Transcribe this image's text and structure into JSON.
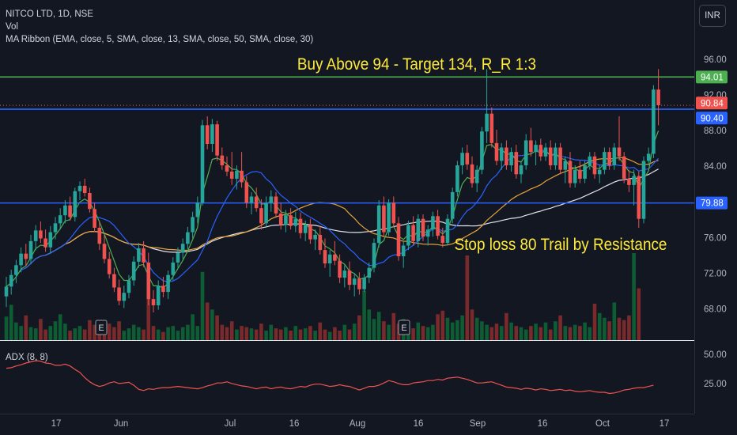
{
  "legend": {
    "symbol_line": "NITCO LTD, 1D, NSE",
    "vol_label": "Vol",
    "ma_label": "MA Ribbon (EMA, close, 5, SMA, close, 13, SMA, close, 50, SMA, close, 30)"
  },
  "currency_button": "INR",
  "annotations": {
    "buy_text": "Buy Above 94 - Target 134, R_R 1:3",
    "stop_text": "Stop loss 80 Trail by Resistance"
  },
  "adx_label": "ADX (8, 8)",
  "colors": {
    "background": "#131722",
    "up": "#26a69a",
    "down": "#ef5350",
    "vol_up": "#0e5c34",
    "vol_down": "#7a2a2b",
    "green_line": "#4caf50",
    "blue_line": "#2962ff",
    "ema5": "#4caf50",
    "sma13": "#2962ff",
    "sma30": "#e6a23c",
    "sma50": "#e0e3eb",
    "adx": "#ef5350",
    "annotation_text": "#ffeb3b"
  },
  "chart_data": {
    "type": "candlestick",
    "symbol": "NITCO LTD",
    "interval": "1D",
    "exchange": "NSE",
    "price_axis": {
      "ticks": [
        "96.00",
        "92.00",
        "88.00",
        "84.00",
        "80.00",
        "76.00",
        "72.00",
        "68.00"
      ],
      "range": [
        64.5,
        97.5
      ]
    },
    "time_axis": {
      "ticks": [
        "17",
        "Jun",
        "Jul",
        "16",
        "Aug",
        "16",
        "Sep",
        "16",
        "Oct",
        "17"
      ]
    },
    "adx_axis": {
      "ticks": [
        "50.00",
        "25.00"
      ],
      "range": [
        0,
        60
      ]
    },
    "horizontal_lines": [
      {
        "price": 94.01,
        "color": "#4caf50",
        "label": "94.01"
      },
      {
        "price": 90.4,
        "color": "#2962ff",
        "label": "90.40"
      },
      {
        "price": 79.88,
        "color": "#2962ff",
        "label": "79.88"
      }
    ],
    "last_price": {
      "value": 90.84,
      "label": "90.84"
    },
    "earnings_markers": [
      {
        "label": "E",
        "date": "Jun"
      },
      {
        "label": "E",
        "date": "Aug"
      }
    ],
    "candles": [
      {
        "o": 69.4,
        "h": 71.6,
        "l": 68.2,
        "c": 70.5
      },
      {
        "o": 70.5,
        "h": 72.4,
        "l": 69.6,
        "c": 71.8
      },
      {
        "o": 71.8,
        "h": 73.5,
        "l": 70.9,
        "c": 72.9
      },
      {
        "o": 72.9,
        "h": 74.9,
        "l": 72.1,
        "c": 74.2
      },
      {
        "o": 74.2,
        "h": 75.3,
        "l": 72.8,
        "c": 73.6
      },
      {
        "o": 73.6,
        "h": 76.3,
        "l": 73.0,
        "c": 75.6
      },
      {
        "o": 75.6,
        "h": 77.4,
        "l": 74.6,
        "c": 76.8
      },
      {
        "o": 76.8,
        "h": 77.8,
        "l": 75.4,
        "c": 75.9
      },
      {
        "o": 75.9,
        "h": 76.9,
        "l": 74.4,
        "c": 74.9
      },
      {
        "o": 74.9,
        "h": 77.3,
        "l": 74.2,
        "c": 76.6
      },
      {
        "o": 76.6,
        "h": 78.3,
        "l": 75.8,
        "c": 77.6
      },
      {
        "o": 77.6,
        "h": 79.3,
        "l": 76.9,
        "c": 78.5
      },
      {
        "o": 78.5,
        "h": 80.2,
        "l": 77.6,
        "c": 79.6
      },
      {
        "o": 79.6,
        "h": 80.6,
        "l": 77.9,
        "c": 78.3
      },
      {
        "o": 78.3,
        "h": 81.6,
        "l": 77.8,
        "c": 81.2
      },
      {
        "o": 81.2,
        "h": 82.3,
        "l": 80.2,
        "c": 81.8
      },
      {
        "o": 81.8,
        "h": 82.6,
        "l": 80.6,
        "c": 81.0
      },
      {
        "o": 81.0,
        "h": 81.6,
        "l": 78.8,
        "c": 79.2
      },
      {
        "o": 79.2,
        "h": 79.9,
        "l": 76.6,
        "c": 77.1
      },
      {
        "o": 77.1,
        "h": 77.8,
        "l": 74.6,
        "c": 75.3
      },
      {
        "o": 75.3,
        "h": 76.3,
        "l": 73.1,
        "c": 73.6
      },
      {
        "o": 73.6,
        "h": 74.4,
        "l": 71.4,
        "c": 71.9
      },
      {
        "o": 71.9,
        "h": 72.6,
        "l": 69.9,
        "c": 70.4
      },
      {
        "o": 70.4,
        "h": 71.3,
        "l": 68.4,
        "c": 68.9
      },
      {
        "o": 68.9,
        "h": 70.6,
        "l": 68.1,
        "c": 69.8
      },
      {
        "o": 69.8,
        "h": 71.8,
        "l": 69.2,
        "c": 71.2
      },
      {
        "o": 71.2,
        "h": 73.9,
        "l": 70.6,
        "c": 73.3
      },
      {
        "o": 73.3,
        "h": 75.4,
        "l": 72.6,
        "c": 74.8
      },
      {
        "o": 74.8,
        "h": 75.6,
        "l": 72.7,
        "c": 73.2
      },
      {
        "o": 73.2,
        "h": 74.3,
        "l": 68.4,
        "c": 69.1
      },
      {
        "o": 69.1,
        "h": 70.1,
        "l": 67.6,
        "c": 68.4
      },
      {
        "o": 68.4,
        "h": 71.2,
        "l": 67.9,
        "c": 70.6
      },
      {
        "o": 70.6,
        "h": 71.6,
        "l": 69.3,
        "c": 69.9
      },
      {
        "o": 69.9,
        "h": 72.3,
        "l": 69.1,
        "c": 71.8
      },
      {
        "o": 71.8,
        "h": 73.8,
        "l": 71.2,
        "c": 73.2
      },
      {
        "o": 73.2,
        "h": 74.9,
        "l": 72.6,
        "c": 74.3
      },
      {
        "o": 74.3,
        "h": 75.9,
        "l": 73.6,
        "c": 75.3
      },
      {
        "o": 75.3,
        "h": 77.2,
        "l": 74.7,
        "c": 76.6
      },
      {
        "o": 76.6,
        "h": 78.9,
        "l": 75.9,
        "c": 78.3
      },
      {
        "o": 78.3,
        "h": 80.6,
        "l": 77.6,
        "c": 79.9
      },
      {
        "o": 79.9,
        "h": 89.2,
        "l": 79.6,
        "c": 88.6
      },
      {
        "o": 88.6,
        "h": 89.6,
        "l": 85.9,
        "c": 86.5
      },
      {
        "o": 86.5,
        "h": 89.3,
        "l": 85.6,
        "c": 88.7
      },
      {
        "o": 88.7,
        "h": 89.1,
        "l": 84.6,
        "c": 85.2
      },
      {
        "o": 85.2,
        "h": 86.1,
        "l": 83.6,
        "c": 84.1
      },
      {
        "o": 84.1,
        "h": 85.1,
        "l": 82.9,
        "c": 83.4
      },
      {
        "o": 83.4,
        "h": 85.6,
        "l": 81.9,
        "c": 82.6
      },
      {
        "o": 82.6,
        "h": 84.1,
        "l": 81.4,
        "c": 83.5
      },
      {
        "o": 83.5,
        "h": 85.6,
        "l": 81.6,
        "c": 82.2
      },
      {
        "o": 82.2,
        "h": 82.9,
        "l": 79.3,
        "c": 79.9
      },
      {
        "o": 79.9,
        "h": 81.1,
        "l": 78.6,
        "c": 80.6
      },
      {
        "o": 80.6,
        "h": 81.6,
        "l": 78.9,
        "c": 79.3
      },
      {
        "o": 79.3,
        "h": 80.3,
        "l": 76.9,
        "c": 77.6
      },
      {
        "o": 77.6,
        "h": 80.6,
        "l": 77.2,
        "c": 79.9
      },
      {
        "o": 79.9,
        "h": 81.3,
        "l": 78.9,
        "c": 80.6
      },
      {
        "o": 80.6,
        "h": 81.1,
        "l": 78.2,
        "c": 78.7
      },
      {
        "o": 78.7,
        "h": 79.9,
        "l": 76.9,
        "c": 77.4
      },
      {
        "o": 77.4,
        "h": 79.1,
        "l": 76.6,
        "c": 78.5
      },
      {
        "o": 78.5,
        "h": 79.3,
        "l": 76.9,
        "c": 77.3
      },
      {
        "o": 77.3,
        "h": 78.9,
        "l": 76.6,
        "c": 78.1
      },
      {
        "o": 78.1,
        "h": 78.8,
        "l": 75.9,
        "c": 76.5
      },
      {
        "o": 76.5,
        "h": 77.9,
        "l": 75.6,
        "c": 77.4
      },
      {
        "o": 77.4,
        "h": 78.1,
        "l": 75.3,
        "c": 75.8
      },
      {
        "o": 75.8,
        "h": 76.9,
        "l": 74.6,
        "c": 76.3
      },
      {
        "o": 76.3,
        "h": 77.3,
        "l": 74.1,
        "c": 74.6
      },
      {
        "o": 74.6,
        "h": 75.9,
        "l": 72.6,
        "c": 73.1
      },
      {
        "o": 73.1,
        "h": 74.6,
        "l": 71.6,
        "c": 74.1
      },
      {
        "o": 74.1,
        "h": 75.6,
        "l": 72.9,
        "c": 73.4
      },
      {
        "o": 73.4,
        "h": 74.1,
        "l": 70.9,
        "c": 71.5
      },
      {
        "o": 71.5,
        "h": 72.9,
        "l": 70.4,
        "c": 72.3
      },
      {
        "o": 72.3,
        "h": 73.3,
        "l": 70.1,
        "c": 70.7
      },
      {
        "o": 70.7,
        "h": 71.9,
        "l": 69.4,
        "c": 71.4
      },
      {
        "o": 71.4,
        "h": 72.1,
        "l": 69.6,
        "c": 70.2
      },
      {
        "o": 70.2,
        "h": 71.9,
        "l": 69.9,
        "c": 71.5
      },
      {
        "o": 71.5,
        "h": 73.2,
        "l": 70.9,
        "c": 72.6
      },
      {
        "o": 72.6,
        "h": 75.9,
        "l": 72.1,
        "c": 75.4
      },
      {
        "o": 75.4,
        "h": 80.2,
        "l": 74.9,
        "c": 79.6
      },
      {
        "o": 79.6,
        "h": 80.6,
        "l": 76.1,
        "c": 76.6
      },
      {
        "o": 76.6,
        "h": 80.3,
        "l": 76.2,
        "c": 79.9
      },
      {
        "o": 79.9,
        "h": 80.6,
        "l": 77.2,
        "c": 77.6
      },
      {
        "o": 77.6,
        "h": 78.3,
        "l": 73.4,
        "c": 73.9
      },
      {
        "o": 73.9,
        "h": 75.6,
        "l": 72.6,
        "c": 75.1
      },
      {
        "o": 75.1,
        "h": 77.9,
        "l": 74.6,
        "c": 77.4
      },
      {
        "o": 77.4,
        "h": 78.4,
        "l": 75.1,
        "c": 75.6
      },
      {
        "o": 75.6,
        "h": 78.6,
        "l": 74.9,
        "c": 78.1
      },
      {
        "o": 78.1,
        "h": 78.6,
        "l": 75.6,
        "c": 76.1
      },
      {
        "o": 76.1,
        "h": 77.4,
        "l": 75.1,
        "c": 76.9
      },
      {
        "o": 76.9,
        "h": 78.9,
        "l": 76.1,
        "c": 78.4
      },
      {
        "o": 78.4,
        "h": 79.1,
        "l": 75.8,
        "c": 76.2
      },
      {
        "o": 76.2,
        "h": 77.1,
        "l": 74.9,
        "c": 75.4
      },
      {
        "o": 75.4,
        "h": 78.6,
        "l": 75.1,
        "c": 78.1
      },
      {
        "o": 78.1,
        "h": 81.6,
        "l": 77.6,
        "c": 81.1
      },
      {
        "o": 81.1,
        "h": 84.6,
        "l": 80.6,
        "c": 84.1
      },
      {
        "o": 84.1,
        "h": 86.1,
        "l": 83.1,
        "c": 85.5
      },
      {
        "o": 85.5,
        "h": 86.4,
        "l": 83.6,
        "c": 84.2
      },
      {
        "o": 84.2,
        "h": 85.1,
        "l": 81.6,
        "c": 82.1
      },
      {
        "o": 82.1,
        "h": 84.1,
        "l": 81.1,
        "c": 83.6
      },
      {
        "o": 83.6,
        "h": 88.4,
        "l": 83.1,
        "c": 87.9
      },
      {
        "o": 87.9,
        "h": 94.9,
        "l": 86.6,
        "c": 89.9
      },
      {
        "o": 89.9,
        "h": 90.6,
        "l": 86.1,
        "c": 86.6
      },
      {
        "o": 86.6,
        "h": 88.1,
        "l": 84.1,
        "c": 84.6
      },
      {
        "o": 84.6,
        "h": 86.6,
        "l": 83.6,
        "c": 86.1
      },
      {
        "o": 86.1,
        "h": 86.9,
        "l": 83.6,
        "c": 84.1
      },
      {
        "o": 84.1,
        "h": 86.1,
        "l": 83.4,
        "c": 85.6
      },
      {
        "o": 85.6,
        "h": 86.4,
        "l": 82.6,
        "c": 83.1
      },
      {
        "o": 83.1,
        "h": 84.6,
        "l": 82.1,
        "c": 84.1
      },
      {
        "o": 84.1,
        "h": 87.6,
        "l": 83.6,
        "c": 86.9
      },
      {
        "o": 86.9,
        "h": 88.3,
        "l": 85.1,
        "c": 85.6
      },
      {
        "o": 85.6,
        "h": 86.9,
        "l": 84.1,
        "c": 86.4
      },
      {
        "o": 86.4,
        "h": 87.1,
        "l": 84.6,
        "c": 85.1
      },
      {
        "o": 85.1,
        "h": 86.6,
        "l": 84.6,
        "c": 86.1
      },
      {
        "o": 86.1,
        "h": 86.9,
        "l": 83.6,
        "c": 84.1
      },
      {
        "o": 84.1,
        "h": 86.6,
        "l": 83.6,
        "c": 86.1
      },
      {
        "o": 86.1,
        "h": 86.6,
        "l": 83.1,
        "c": 83.6
      },
      {
        "o": 83.6,
        "h": 85.1,
        "l": 82.1,
        "c": 84.6
      },
      {
        "o": 84.6,
        "h": 85.6,
        "l": 81.6,
        "c": 82.1
      },
      {
        "o": 82.1,
        "h": 84.1,
        "l": 81.6,
        "c": 83.6
      },
      {
        "o": 83.6,
        "h": 84.6,
        "l": 82.1,
        "c": 82.6
      },
      {
        "o": 82.6,
        "h": 84.6,
        "l": 82.1,
        "c": 84.1
      },
      {
        "o": 84.1,
        "h": 85.6,
        "l": 83.6,
        "c": 85.1
      },
      {
        "o": 85.1,
        "h": 85.6,
        "l": 82.6,
        "c": 83.1
      },
      {
        "o": 83.1,
        "h": 84.1,
        "l": 82.1,
        "c": 83.6
      },
      {
        "o": 83.6,
        "h": 86.1,
        "l": 83.1,
        "c": 85.6
      },
      {
        "o": 85.6,
        "h": 86.1,
        "l": 83.6,
        "c": 84.1
      },
      {
        "o": 84.1,
        "h": 86.6,
        "l": 83.6,
        "c": 86.1
      },
      {
        "o": 86.1,
        "h": 89.6,
        "l": 84.6,
        "c": 85.1
      },
      {
        "o": 85.1,
        "h": 85.6,
        "l": 82.1,
        "c": 82.6
      },
      {
        "o": 82.6,
        "h": 83.6,
        "l": 81.1,
        "c": 81.9
      },
      {
        "o": 81.9,
        "h": 83.6,
        "l": 79.6,
        "c": 82.9
      },
      {
        "o": 82.9,
        "h": 83.4,
        "l": 77.1,
        "c": 78.1
      },
      {
        "o": 78.1,
        "h": 85.1,
        "l": 77.6,
        "c": 84.6
      },
      {
        "o": 84.6,
        "h": 86.1,
        "l": 84.1,
        "c": 85.4
      },
      {
        "o": 85.4,
        "h": 93.1,
        "l": 84.9,
        "c": 92.6
      },
      {
        "o": 92.6,
        "h": 94.9,
        "l": 88.6,
        "c": 90.84
      }
    ],
    "volume": [
      2,
      3,
      1.5,
      1.2,
      2.1,
      1.1,
      1,
      1.8,
      0.9,
      1.2,
      1.6,
      2.2,
      1.4,
      0.8,
      1,
      1.2,
      0.9,
      1.7,
      1.3,
      1.5,
      1.2,
      1.4,
      1.1,
      1.6,
      0.8,
      1,
      1.3,
      1.1,
      0.9,
      3.6,
      1.2,
      0.9,
      0.7,
      1.1,
      1.2,
      0.8,
      1.1,
      1.3,
      2.2,
      1.2,
      5.8,
      3.2,
      2.6,
      2.1,
      1.3,
      1.1,
      1.6,
      0.9,
      1.2,
      1.1,
      1,
      0.9,
      1.4,
      0.8,
      1.3,
      1,
      0.9,
      1.1,
      0.8,
      1.2,
      0.9,
      1,
      1.2,
      0.8,
      1.5,
      0.9,
      0.7,
      1.1,
      0.8,
      1.3,
      0.9,
      1.4,
      2.1,
      4.2,
      2.6,
      1.8,
      2.4,
      1.6,
      1.3,
      2.3,
      1.4,
      1.8,
      1.1,
      1,
      1.5,
      1.2,
      1.1,
      1.3,
      2.2,
      2.5,
      1.9,
      1.5,
      1.7,
      2.1,
      7.2,
      2.6,
      1.9,
      1.6,
      1.3,
      1.1,
      1.4,
      1.2,
      2.3,
      1.5,
      1.2,
      1.1,
      0.9,
      1.2,
      1.4,
      1.1,
      1.5,
      0.9,
      1.6,
      2.1,
      1.2,
      1.1,
      1.3,
      1.2,
      1.5,
      1.1,
      3.1,
      2.3,
      1.9,
      1.6,
      3.2,
      1.9,
      1.7,
      2.1,
      7.4,
      4.4
    ],
    "adx": [
      38,
      38.5,
      40,
      41,
      42.5,
      43.5,
      44.5,
      44,
      42.5,
      42,
      40.5,
      40.5,
      41.5,
      40,
      37,
      34.5,
      30,
      26.5,
      24,
      22.5,
      23.5,
      25.5,
      26.5,
      25,
      25.5,
      26,
      23.5,
      20,
      19,
      20.5,
      20,
      21,
      21.5,
      21.5,
      22,
      22.5,
      22,
      21.5,
      21,
      20.5,
      21.5,
      23,
      24,
      25.5,
      25.5,
      26.5,
      25,
      24,
      23,
      22.5,
      21.5,
      20.5,
      21.5,
      22,
      20.5,
      21.5,
      22,
      21,
      20.5,
      21.5,
      22.5,
      22,
      23.5,
      24.5,
      24.5,
      23.5,
      22.5,
      23,
      24,
      23,
      22.5,
      21,
      19.5,
      21,
      22.5,
      22.5,
      23.5,
      25.5,
      27.5,
      26.5,
      25,
      24,
      24,
      25.5,
      26,
      26.5,
      27.5,
      27.5,
      28.5,
      28,
      29.5,
      30,
      30.5,
      29.5,
      28.5,
      27,
      25.5,
      25.5,
      26,
      26.5,
      25,
      23.5,
      22,
      21.5,
      21,
      20,
      21,
      20.5,
      19.5,
      20.5,
      20,
      19,
      19.5,
      20,
      19,
      19.5,
      18.5,
      18,
      18.5,
      19,
      18,
      17.5,
      17.5,
      16.5,
      17,
      18,
      19.5,
      20,
      21,
      21.5,
      21.5,
      22.5,
      23.5
    ]
  }
}
